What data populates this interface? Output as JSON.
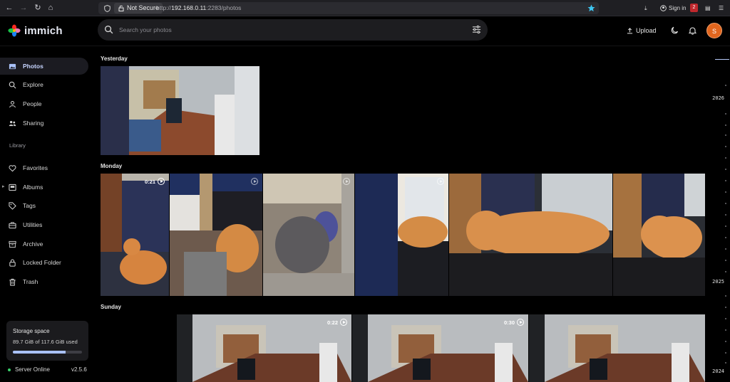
{
  "browser": {
    "security_badge": "Not Secure",
    "url_prefix": "http://",
    "url_host": "192.168.0.11",
    "url_path": ":2283/photos",
    "sign_in": "Sign in",
    "ext_badge": "2"
  },
  "app": {
    "name": "immich"
  },
  "search": {
    "placeholder": "Search your photos"
  },
  "header": {
    "upload_label": "Upload",
    "avatar_initial": "S"
  },
  "sidebar": {
    "items": [
      {
        "label": "Photos",
        "icon": "photos-icon"
      },
      {
        "label": "Explore",
        "icon": "explore-icon"
      },
      {
        "label": "People",
        "icon": "people-icon"
      },
      {
        "label": "Sharing",
        "icon": "sharing-icon"
      },
      {
        "label": "Favorites",
        "icon": "heart-icon"
      },
      {
        "label": "Albums",
        "icon": "albums-icon"
      },
      {
        "label": "Tags",
        "icon": "tag-icon"
      },
      {
        "label": "Utilities",
        "icon": "utilities-icon"
      },
      {
        "label": "Archive",
        "icon": "archive-icon"
      },
      {
        "label": "Locked Folder",
        "icon": "lock-icon"
      },
      {
        "label": "Trash",
        "icon": "trash-icon"
      }
    ],
    "library_label": "Library"
  },
  "storage": {
    "title": "Storage space",
    "used_text": "89.7 GiB of 117.6 GiB used",
    "used_fraction": 0.763
  },
  "server": {
    "status": "Server Online",
    "version": "v2.5.6"
  },
  "timeline": {
    "groups": [
      {
        "label": "Yesterday"
      },
      {
        "label": "Monday"
      },
      {
        "label": "Sunday"
      }
    ],
    "durations": {
      "monday_1": "0:21",
      "sunday_1": "0:22",
      "sunday_2": "0:30"
    }
  },
  "scrubber": {
    "years": [
      "2026",
      "2025",
      "2024"
    ]
  },
  "colors": {
    "accent": "#a9c1f8",
    "avatar": "#e2661e",
    "online": "#39d06b"
  }
}
